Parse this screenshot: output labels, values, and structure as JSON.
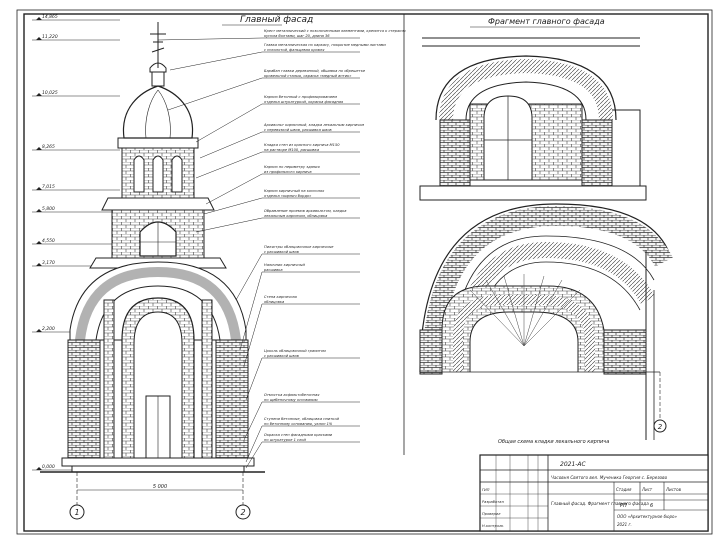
{
  "left_drawing": {
    "title": "Главный фасад",
    "levels": [
      "14,865",
      "11,220",
      "10,025",
      "8,265",
      "7,015",
      "5,800",
      "4,550",
      "3,170",
      "2,200",
      "0,000"
    ],
    "notes": [
      {
        "l1": "Крест металлический с позолоченными элементами, крепится к стержню",
        "l2": "купола болтами, шаг 20, длина 36"
      },
      {
        "l1": "Главка металлическая по каркасу, покрытие медными листами",
        "l2": "с позолотой, фальцевая кровля"
      },
      {
        "l1": "Барабан главки деревянный, обшивка по обрешетке",
        "l2": "кровельной сталью, окраска «медный антик»"
      },
      {
        "l1": "Карниз бетонный с профилированием",
        "l2": "отделка штукатуркой, окраска фасадная"
      },
      {
        "l1": "Архивольт кирпичный, кладка лекальным кирпичом",
        "l2": "с перевязкой швов, расшивка швов"
      },
      {
        "l1": "Кладка стен из красного кирпича М150",
        "l2": "на растворе М100, расшивка"
      },
      {
        "l1": "Карниз по периметру здания",
        "l2": "из профильного кирпича"
      },
      {
        "l1": "Карниз кирпичный на консолях",
        "l2": "отделка «кирпич бордо»"
      },
      {
        "l1": "Обрамление проемов архивольтом, кладка",
        "l2": "лекальным кирпичом, облицовка"
      },
      {
        "l1": "Пилястры облицовочные кирпичные",
        "l2": "с расшивкой швов"
      },
      {
        "l1": "Наличник кирпичный",
        "l2": "расшивка"
      },
      {
        "l1": "Стена кирпичная",
        "l2": "облицовка"
      },
      {
        "l1": "Цоколь облицовочный гранитом",
        "l2": "с расшивкой швов"
      },
      {
        "l1": "Отмостка асфальтобетонная",
        "l2": "по щебеночному основанию"
      },
      {
        "l1": "Ступени бетонные, облицовка плиткой",
        "l2": "по бетонному основанию, уклон 1%"
      },
      {
        "l1": "Окраска стен фасадными красками",
        "l2": "по штукатурке 1 слой"
      }
    ],
    "axes": [
      "1",
      "2"
    ],
    "dimension": "5 000"
  },
  "right_drawing": {
    "title": "Фрагмент главного фасада",
    "caption": "Общая схема кладки лекального кирпича",
    "axis": "2"
  },
  "stamp": {
    "code": "2021-АС",
    "object_name": "Часовня Святого вел. Мученика Георгия с. Березово",
    "section": "Главный фасад. Фрагмент главного фасада",
    "stage_label": "Стадия",
    "sheet_label": "Лист",
    "sheets_label": "Листов",
    "stage": "РП",
    "sheet": "6",
    "org": "ООО «Архитектурное бюро»",
    "year": "2021 г.",
    "signers": [
      "Разработал",
      "Проверил",
      "Н.контроль",
      "ГИП"
    ]
  },
  "colors": {
    "ink": "#222222",
    "brick": "#555555",
    "paper": "#ffffff"
  }
}
